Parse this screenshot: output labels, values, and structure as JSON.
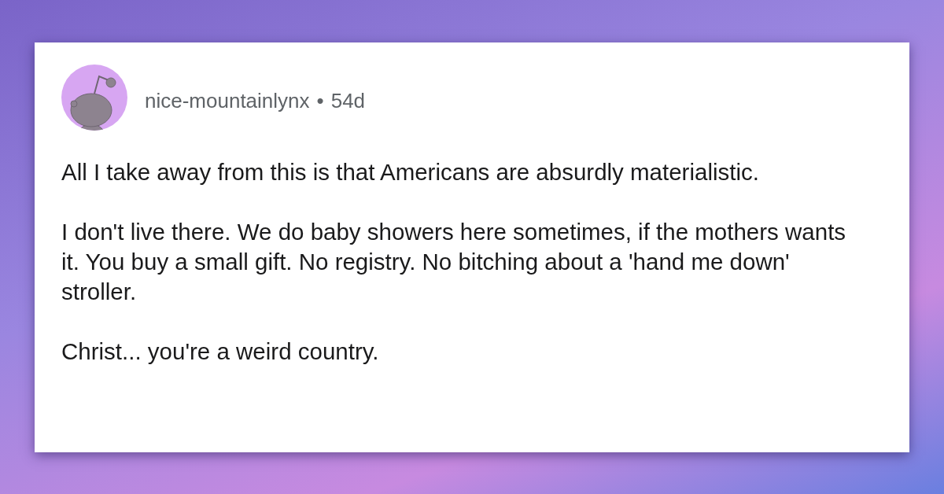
{
  "comment": {
    "username": "nice-mountainlynx",
    "separator": "•",
    "age": "54d",
    "paragraphs": [
      "All I take away from this is that Americans are absurdly materialistic.",
      "I don't live there. We do baby showers here sometimes, if the mothers wants it. You buy a small gift. No registry. No bitching about a 'hand me down' stroller.",
      "Christ... you're a weird country."
    ]
  }
}
